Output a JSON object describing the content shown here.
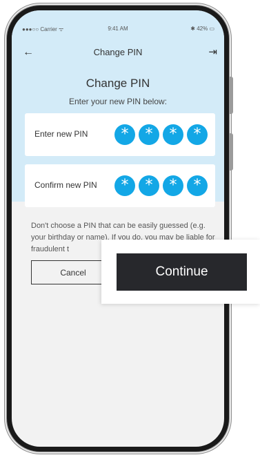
{
  "status_bar": {
    "carrier": "●●●○○ Carrier ᯤ",
    "time": "9:41 AM",
    "battery": "✱ 42% ▭"
  },
  "nav": {
    "back_icon": "←",
    "title": "Change PIN",
    "logout_icon": "⇥"
  },
  "heading": "Change PIN",
  "subheading": "Enter your new PIN below:",
  "new_pin": {
    "label": "Enter new PIN",
    "digits": [
      "*",
      "*",
      "*",
      "*"
    ]
  },
  "confirm_pin": {
    "label": "Confirm new PIN",
    "digits": [
      "*",
      "*",
      "*",
      "*"
    ]
  },
  "note": "Don't choose a PIN that can be easily guessed (e.g. your birthday or name). If you do, you may be liable for fraudulent t",
  "cancel_label": "Cancel",
  "continue_label": "Continue",
  "colors": {
    "header_bg": "#d3ebf8",
    "pin_dot": "#13a7e6",
    "continue_bg": "#27282c"
  }
}
